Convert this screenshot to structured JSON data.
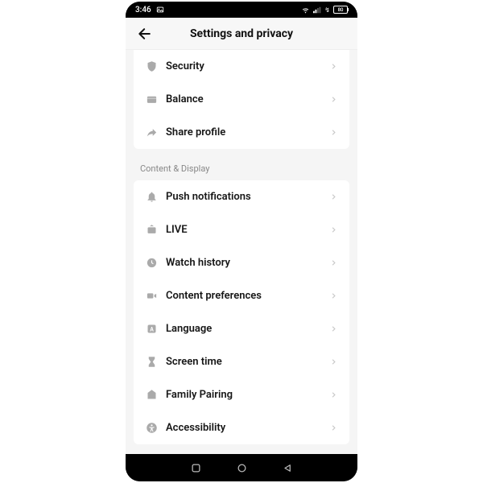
{
  "status": {
    "time": "3:46",
    "battery": "80"
  },
  "header": {
    "title": "Settings and privacy"
  },
  "groups": [
    {
      "items": [
        {
          "key": "security",
          "label": "Security"
        },
        {
          "key": "balance",
          "label": "Balance"
        },
        {
          "key": "share-profile",
          "label": "Share profile"
        }
      ]
    },
    {
      "title": "Content & Display",
      "items": [
        {
          "key": "push-notifications",
          "label": "Push notifications"
        },
        {
          "key": "live",
          "label": "LIVE"
        },
        {
          "key": "watch-history",
          "label": "Watch history"
        },
        {
          "key": "content-preferences",
          "label": "Content preferences"
        },
        {
          "key": "language",
          "label": "Language"
        },
        {
          "key": "screen-time",
          "label": "Screen time"
        },
        {
          "key": "family-pairing",
          "label": "Family Pairing"
        },
        {
          "key": "accessibility",
          "label": "Accessibility"
        }
      ]
    }
  ]
}
